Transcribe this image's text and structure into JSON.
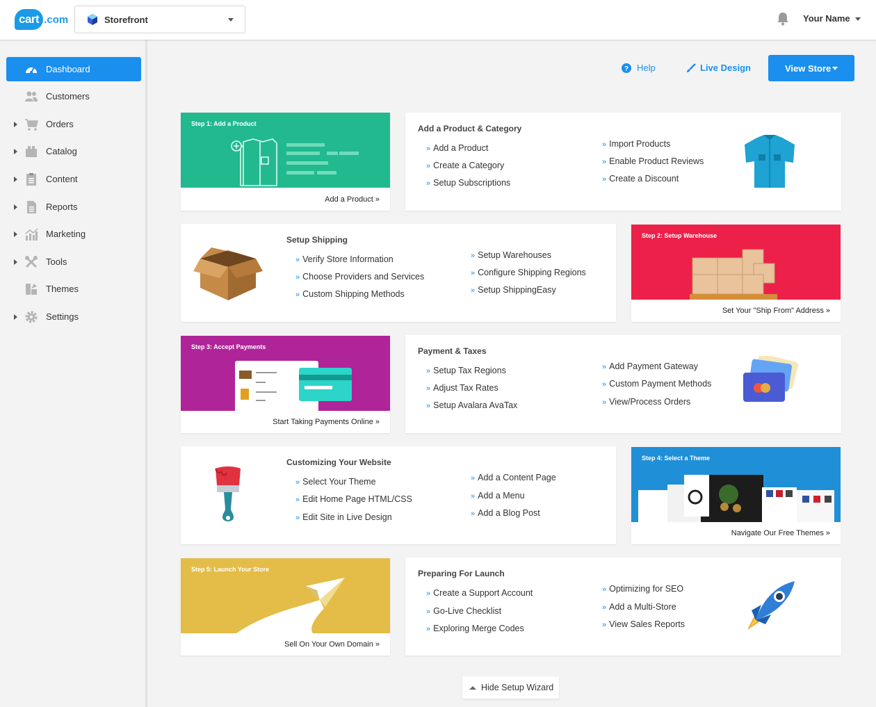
{
  "header": {
    "logo_text": "cart",
    "logo_domain": ".com",
    "store_name": "Storefront",
    "user_name": "Your Name"
  },
  "sidebar": {
    "items": [
      {
        "label": "Dashboard",
        "icon": "dashboard-icon",
        "active": true
      },
      {
        "label": "Customers",
        "icon": "customers-icon"
      },
      {
        "label": "Orders",
        "icon": "cart-icon"
      },
      {
        "label": "Catalog",
        "icon": "catalog-icon"
      },
      {
        "label": "Content",
        "icon": "content-icon"
      },
      {
        "label": "Reports",
        "icon": "reports-icon"
      },
      {
        "label": "Marketing",
        "icon": "marketing-icon"
      },
      {
        "label": "Tools",
        "icon": "tools-icon"
      },
      {
        "label": "Themes",
        "icon": "themes-icon"
      },
      {
        "label": "Settings",
        "icon": "gear-icon"
      }
    ]
  },
  "toolbar": {
    "help": "Help",
    "live_design": "Live Design",
    "view_store": "View Store"
  },
  "sections": {
    "product": {
      "step_title": "Step 1: Add a Product",
      "step_link": "Add a Product »",
      "title": "Add a Product & Category",
      "col1": [
        "Add a Product",
        "Create a Category",
        "Setup Subscriptions"
      ],
      "col2": [
        "Import Products",
        "Enable Product Reviews",
        "Create a Discount"
      ]
    },
    "shipping": {
      "step_title": "Step 2: Setup Warehouse",
      "step_link": "Set Your \"Ship From\" Address »",
      "title": "Setup Shipping",
      "col1": [
        "Verify Store Information",
        "Choose Providers and Services",
        "Custom Shipping Methods"
      ],
      "col2": [
        "Setup Warehouses",
        "Configure Shipping Regions",
        "Setup ShippingEasy"
      ]
    },
    "payment": {
      "step_title": "Step 3: Accept Payments",
      "step_link": "Start Taking Payments Online »",
      "title": "Payment & Taxes",
      "col1": [
        "Setup Tax Regions",
        "Adjust Tax Rates",
        "Setup Avalara AvaTax"
      ],
      "col2": [
        "Add Payment Gateway",
        "Custom Payment Methods",
        "View/Process Orders"
      ]
    },
    "website": {
      "step_title": "Step 4: Select a Theme",
      "step_link": "Navigate Our Free Themes »",
      "title": "Customizing Your Website",
      "col1": [
        "Select Your Theme",
        "Edit Home Page HTML/CSS",
        "Edit Site in Live Design"
      ],
      "col2": [
        "Add a Content Page",
        "Add a Menu",
        "Add a Blog Post"
      ]
    },
    "launch": {
      "step_title": "Step 5: Launch Your Store",
      "step_link": "Sell On Your Own Domain »",
      "title": "Preparing For Launch",
      "col1": [
        "Create a Support Account",
        "Go-Live Checklist",
        "Exploring Merge Codes"
      ],
      "col2": [
        "Optimizing for SEO",
        "Add a Multi-Store",
        "View Sales Reports"
      ]
    }
  },
  "footer": {
    "hide_wizard": "Hide Setup Wizard"
  },
  "colors": {
    "accent": "#1a8fee",
    "step1": "#22b98f",
    "step2": "#ec2049",
    "step3": "#b02499",
    "step4": "#1f8fd8",
    "step5": "#e3bd48"
  }
}
